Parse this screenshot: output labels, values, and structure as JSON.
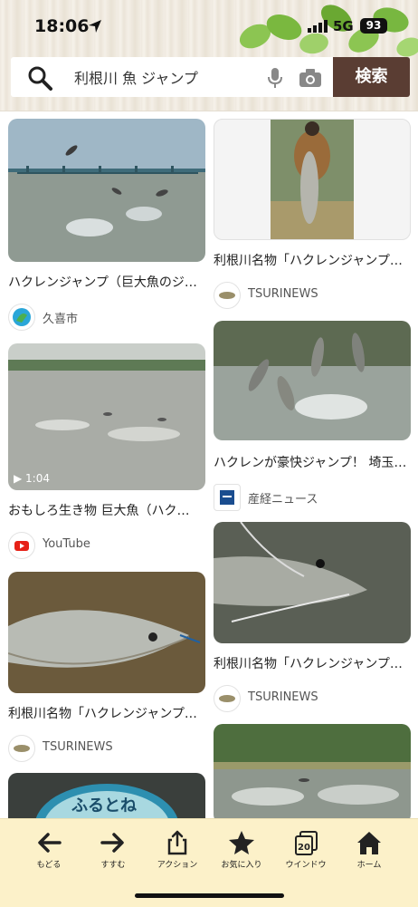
{
  "status": {
    "time": "18:06",
    "network": "5G",
    "battery": "93"
  },
  "search": {
    "query": "利根川 魚 ジャンプ",
    "button_label": "検索"
  },
  "results": [
    {
      "title": "ハクレンジャンプ（巨大魚のジ…",
      "source": "久喜市"
    },
    {
      "title": "利根川名物「ハクレンジャンプ…",
      "source": "TSURINEWS"
    },
    {
      "title": "おもしろ生き物 巨大魚（ハク…",
      "source": "YouTube",
      "duration": "1:04"
    },
    {
      "title": "ハクレンが豪快ジャンプ！ 埼玉…",
      "source": "産経ニュース"
    },
    {
      "title": "利根川名物「ハクレンジャンプ…",
      "source": "TSURINEWS"
    },
    {
      "title": "利根川名物「ハクレンジャンプ…",
      "source": "TSURINEWS"
    },
    {
      "manhole_text": "ふるとね"
    }
  ],
  "toolbar": {
    "back": "もどる",
    "forward": "すすむ",
    "action": "アクション",
    "favorites": "お気に入り",
    "windows": "ウインドウ",
    "window_count": "20",
    "home": "ホーム"
  },
  "colors": {
    "search_button": "#5a3d33",
    "toolbar_bg": "#fcf1c9",
    "youtube": "#e62117"
  }
}
